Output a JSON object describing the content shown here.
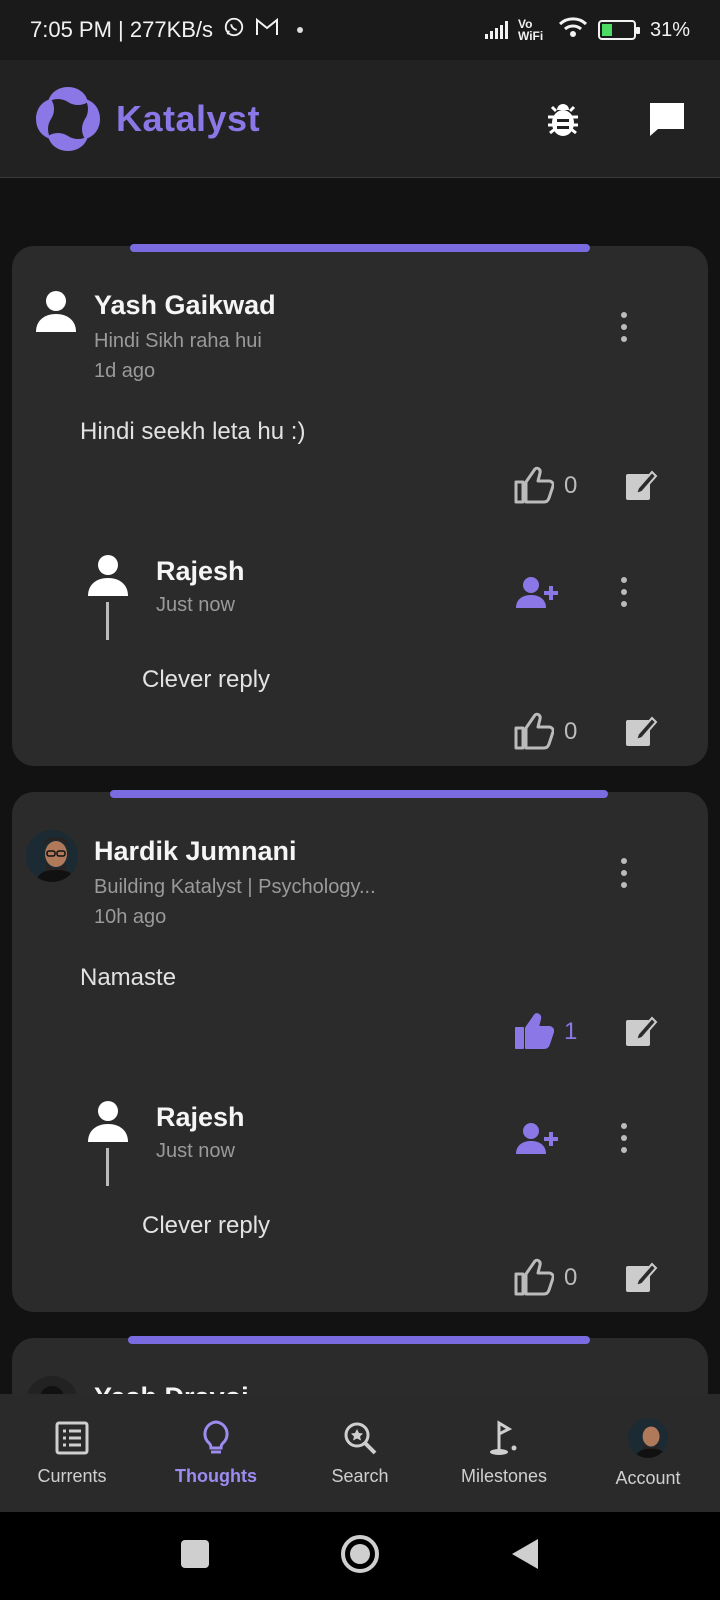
{
  "status_bar": {
    "time_speed": "7:05 PM | 277KB/s",
    "vo_wifi": "Vo WiFi",
    "battery": "31%"
  },
  "header": {
    "app_name": "Katalyst",
    "brand_color": "#8b78e6"
  },
  "posts": [
    {
      "author": "Yash Gaikwad",
      "subtitle": "Hindi Sikh raha hui",
      "time": "1d ago",
      "text": "Hindi seekh leta hu :)",
      "likes": "0",
      "liked": false,
      "reply": {
        "author": "Rajesh",
        "time": "Just now",
        "text": "Clever reply",
        "likes": "0"
      }
    },
    {
      "author": "Hardik Jumnani",
      "subtitle": "Building Katalyst | Psychology...",
      "time": "10h ago",
      "text": "Namaste",
      "likes": "1",
      "liked": true,
      "reply": {
        "author": "Rajesh",
        "time": "Just now",
        "text": "Clever reply",
        "likes": "0"
      }
    },
    {
      "author": "Yash Dravoi"
    }
  ],
  "bottom_nav": [
    {
      "label": "Currents",
      "icon": "list-icon",
      "active": false
    },
    {
      "label": "Thoughts",
      "icon": "lightbulb-icon",
      "active": true
    },
    {
      "label": "Search",
      "icon": "search-icon",
      "active": false
    },
    {
      "label": "Milestones",
      "icon": "golf-flag-icon",
      "active": false
    },
    {
      "label": "Account",
      "icon": "avatar",
      "active": false
    }
  ]
}
